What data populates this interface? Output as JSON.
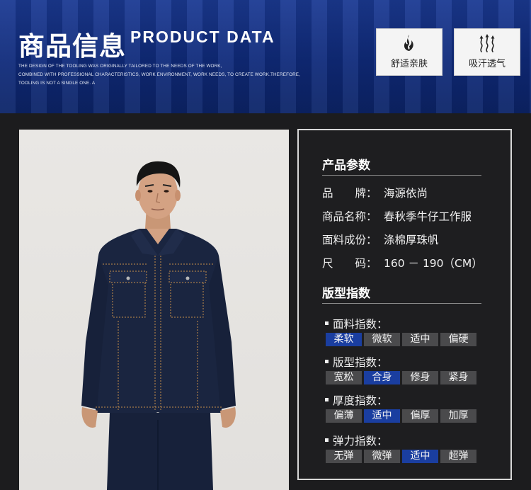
{
  "header": {
    "title_cn": "商品信息",
    "title_en": "PRODUCT DATA",
    "description_lines": [
      "THE DESIGN OF THE TOOLING WAS ORIGINALLY TAILORED TO THE NEEDS OF THE WORK,",
      "COMBINED WITH PROFESSIONAL CHARACTERISTICS, WORK ENVIRONMENT, WORK NEEDS, TO CREATE WORK.THEREFORE,",
      "TOOLING IS NOT A SINGLE ONE. A"
    ],
    "features": [
      {
        "label": "舒适亲肤",
        "icon": "flame-icon"
      },
      {
        "label": "吸汗透气",
        "icon": "airflow-arrows-icon"
      }
    ]
  },
  "params": {
    "title": "产品参数",
    "rows": [
      {
        "key": "品　　牌：",
        "value": "海源依尚"
      },
      {
        "key": "商品名称：",
        "value": "春秋季牛仔工作服"
      },
      {
        "key": "面料成份：",
        "value": "涤棉厚珠帆"
      },
      {
        "key": "尺　　码：",
        "value": "160 － 190（CM）"
      }
    ]
  },
  "fit": {
    "title": "版型指数",
    "groups": [
      {
        "label": "面料指数：",
        "options": [
          "柔软",
          "微软",
          "适中",
          "偏硬"
        ],
        "selected": 0
      },
      {
        "label": "版型指数：",
        "options": [
          "宽松",
          "合身",
          "修身",
          "紧身"
        ],
        "selected": 1
      },
      {
        "label": "厚度指数：",
        "options": [
          "偏薄",
          "适中",
          "偏厚",
          "加厚"
        ],
        "selected": 1
      },
      {
        "label": "弹力指数：",
        "options": [
          "无弹",
          "微弹",
          "适中",
          "超弹"
        ],
        "selected": 2
      }
    ]
  },
  "colors": {
    "header_blue": "#0f2a7a",
    "selected_chip": "#1a3ea0",
    "chip": "#4a4a4c",
    "denim": "#1a2540",
    "stitch": "#c8904a"
  }
}
